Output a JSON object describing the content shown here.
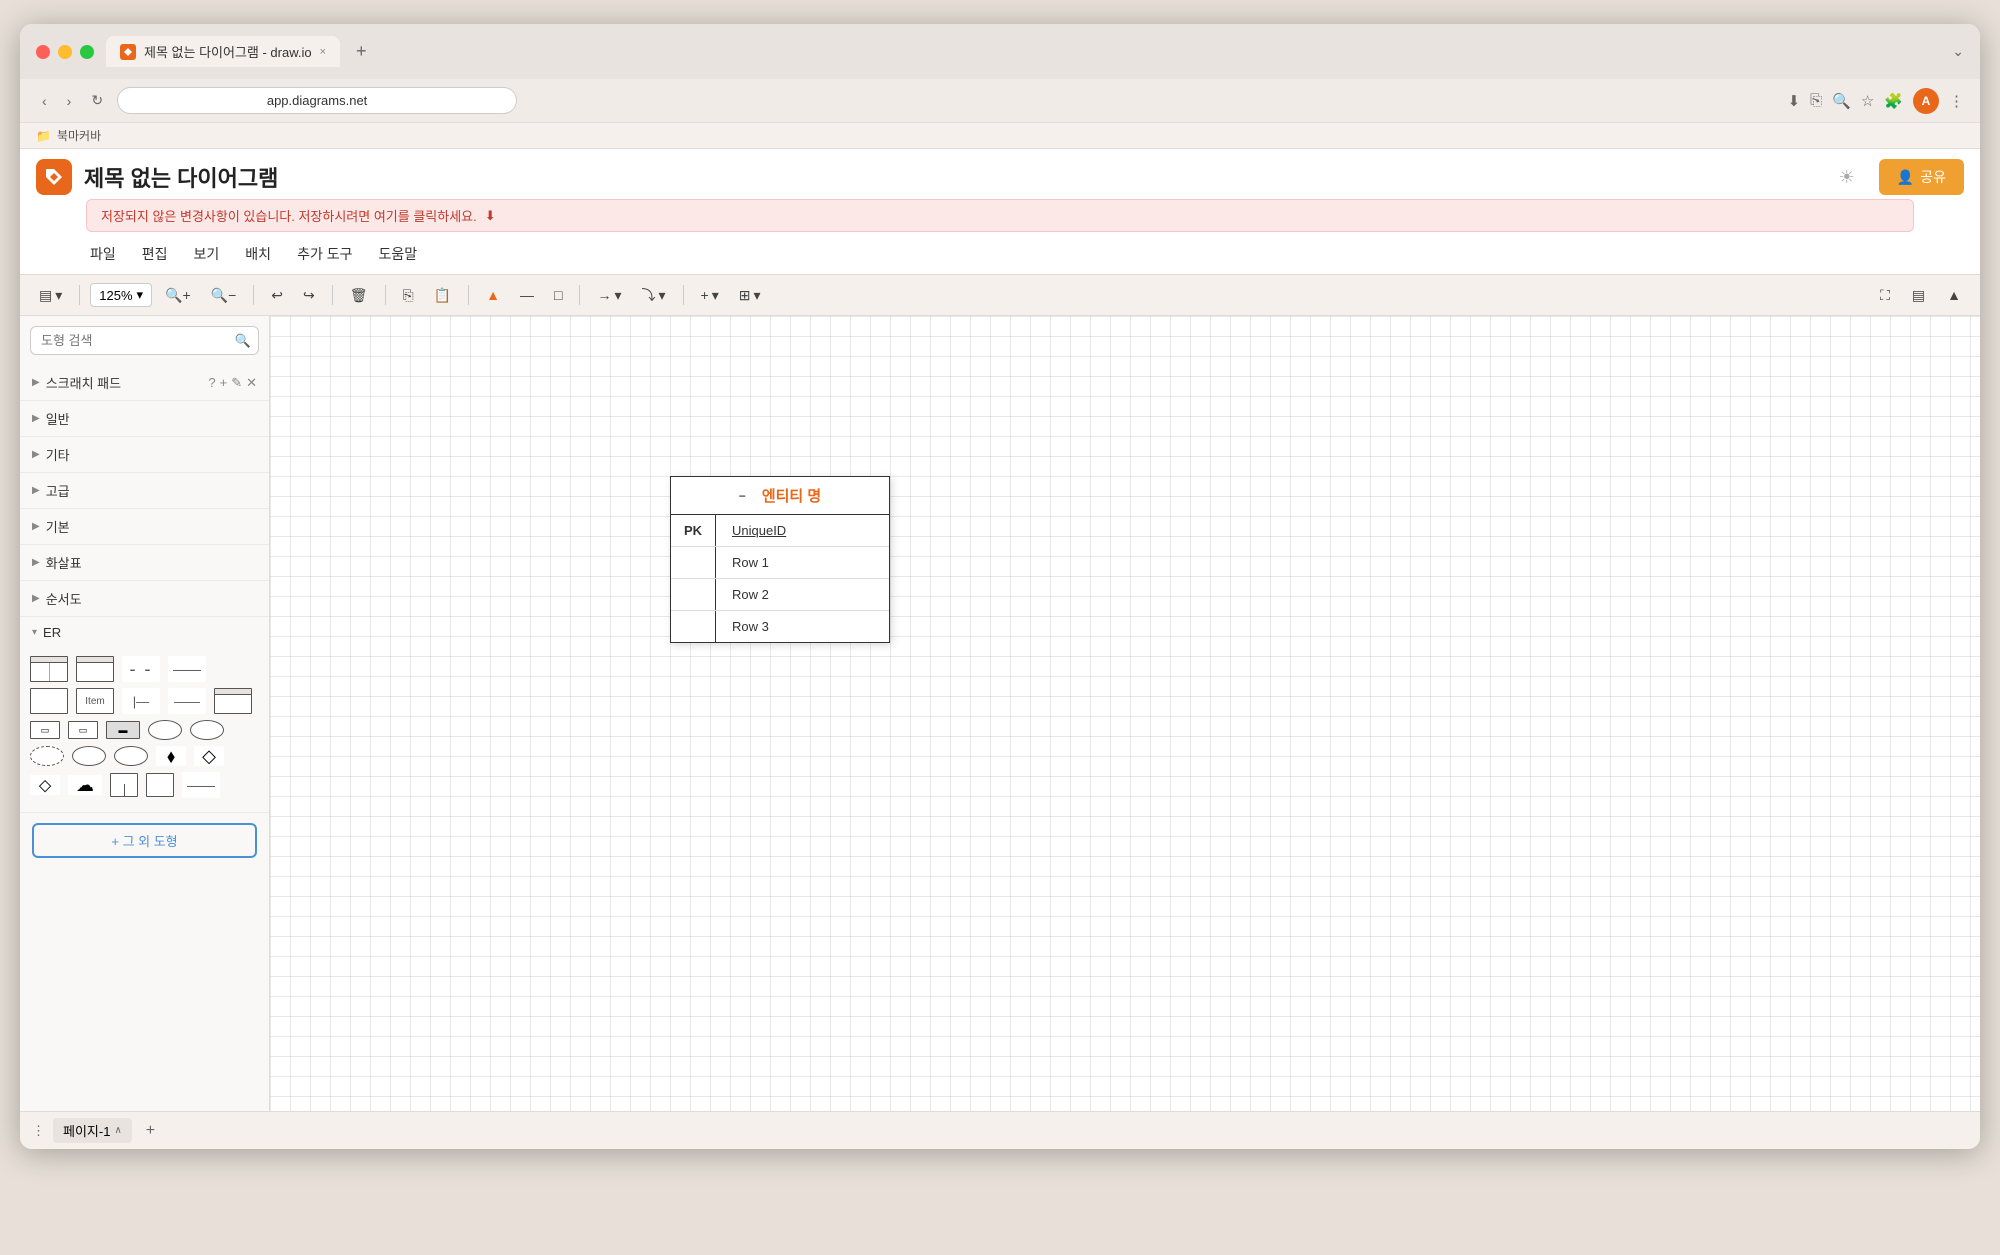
{
  "browser": {
    "traffic_lights": [
      "red",
      "yellow",
      "green"
    ],
    "tab_title": "제목 없는 다이어그램 - draw.io",
    "tab_close": "×",
    "new_tab": "+",
    "url": "app.diagrams.net",
    "expand_label": "⌄",
    "bookmarks_icon": "📁",
    "bookmarks_label": "북마커바"
  },
  "app": {
    "logo_letter": "A",
    "title": "제목 없는 다이어그램",
    "sun_icon": "☀",
    "share_icon": "👤",
    "share_label": "공유",
    "menu": [
      "파일",
      "편집",
      "보기",
      "배치",
      "추가 도구",
      "도움말"
    ],
    "save_notice": "저장되지 않은 변경사항이 있습니다. 저장하시려면 여기를 클릭하세요.",
    "save_icon": "⬇"
  },
  "toolbar": {
    "sidebar_toggle": "☰",
    "zoom_value": "125%",
    "zoom_chevron": "▾",
    "zoom_in": "+",
    "zoom_out": "−",
    "undo": "↩",
    "redo": "↪",
    "delete": "🗑",
    "copy": "⎘",
    "paste": "📋",
    "fill_color": "◈",
    "line_color": "—",
    "shape_btn": "□",
    "connection": "→",
    "waypoint": "⤵",
    "insert": "+",
    "table": "⊞",
    "fullscreen": "⛶",
    "panel": "▤",
    "collapse": "▲"
  },
  "sidebar": {
    "search_placeholder": "도형 검색",
    "sections": [
      {
        "id": "scratch",
        "label": "스크래치 패드",
        "expanded": true,
        "has_help": true,
        "has_add": true,
        "has_edit": true,
        "has_close": true
      },
      {
        "id": "general",
        "label": "일반",
        "expanded": false
      },
      {
        "id": "other",
        "label": "기타",
        "expanded": false
      },
      {
        "id": "advanced",
        "label": "고급",
        "expanded": false
      },
      {
        "id": "basic",
        "label": "기본",
        "expanded": false
      },
      {
        "id": "arrows",
        "label": "화살표",
        "expanded": false
      },
      {
        "id": "flowchart",
        "label": "순서도",
        "expanded": false
      },
      {
        "id": "er",
        "label": "ER",
        "expanded": true
      }
    ],
    "er_shapes_row1": [
      "table",
      "table2",
      "dash",
      "dash2"
    ],
    "er_shapes_row2": [
      "rect",
      "item",
      "dash3",
      "rect2"
    ],
    "er_item_label": "Item",
    "more_shapes_label": "+ 그 외 도형"
  },
  "entity": {
    "minimize_icon": "−",
    "title": "엔티티 명",
    "pk_label": "PK",
    "unique_id": "UniqueID",
    "rows": [
      "Row 1",
      "Row 2",
      "Row 3"
    ]
  },
  "pages": {
    "page_label": "페이지-1",
    "page_chevron": "∧",
    "add_page": "+",
    "more_icon": "⋮"
  }
}
